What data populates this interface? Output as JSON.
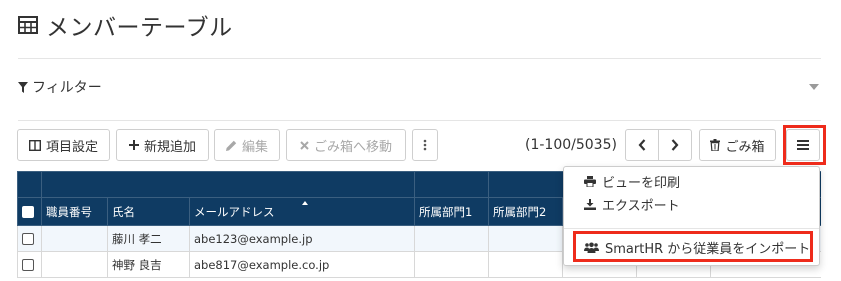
{
  "page": {
    "title": "メンバーテーブル",
    "title_icon": "table-icon"
  },
  "filter": {
    "label": "フィルター",
    "icon": "filter-icon",
    "toggle_icon": "caret-down-icon"
  },
  "toolbar": {
    "column_settings": "項目設定",
    "new": "新規追加",
    "edit": "編集",
    "move_to_trash": "ごみ箱へ移動",
    "more": "more-vertical-icon",
    "pagination": "(1-100/5035)",
    "trash": "ごみ箱",
    "menu": "menu-icon"
  },
  "table": {
    "columns": [
      "職員番号",
      "氏名",
      "メールアドレス",
      "所属部門1",
      "所属部門2",
      "",
      "",
      "",
      ""
    ],
    "rows": [
      [
        "",
        "藤川 孝二",
        "abe123@example.jp",
        "",
        "",
        "",
        "",
        "",
        ""
      ],
      [
        "",
        "神野 良吉",
        "abe817@example.co.jp",
        "",
        "",
        "",
        "",
        "",
        ""
      ]
    ],
    "header_color": "#0f3b63",
    "sorted_column": "メールアドレス"
  },
  "menu": {
    "items": [
      {
        "label": "ビューを印刷",
        "icon": "print-icon"
      },
      {
        "label": "エクスポート",
        "icon": "download-icon"
      },
      {
        "label": "SmartHR から従業員をインポート",
        "icon": "users-icon"
      }
    ]
  },
  "highlight_color": "#ee2b1b"
}
